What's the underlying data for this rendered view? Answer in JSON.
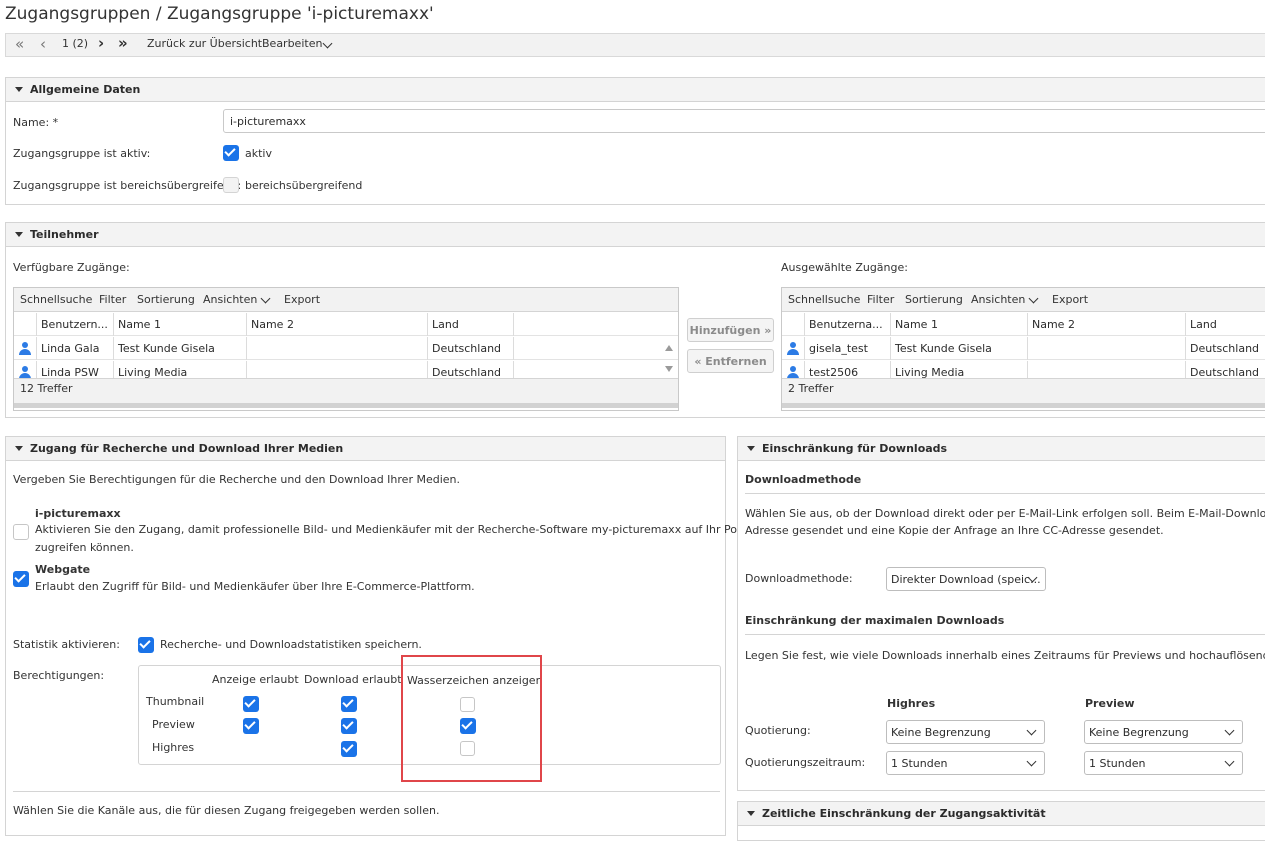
{
  "page_title": "Zugangsgruppen / Zugangsgruppe 'i-picturemaxx'",
  "toolbar": {
    "first": "«",
    "prev": "‹",
    "page_indicator": "1 (2)",
    "next": "›",
    "last": "»",
    "back_label": "Zurück zur Übersicht",
    "edit_label": "Bearbeiten"
  },
  "general": {
    "title": "Allgemeine Daten",
    "name_label": "Name: *",
    "name_value": "i-picturemaxx",
    "active_label": "Zugangsgruppe ist aktiv:",
    "active_text": "aktiv",
    "active_checked": true,
    "cross_label": "Zugangsgruppe ist bereichsübergreifend:",
    "cross_text": "bereichsübergreifend",
    "cross_checked": false
  },
  "participants": {
    "title": "Teilnehmer",
    "available_label": "Verfügbare Zugänge:",
    "selected_label": "Ausgewählte Zugänge:",
    "grid_toolbar": [
      "Schnellsuche",
      "Filter",
      "Sortierung",
      "Ansichten",
      "Export"
    ],
    "columns": [
      "Benutzern...",
      "Name 1",
      "Name 2",
      "Land"
    ],
    "columns_right": [
      "Benutzerna...",
      "Name 1",
      "Name 2",
      "Land"
    ],
    "available_rows": [
      {
        "user": "Linda Gala",
        "name1": "Test Kunde Gisela",
        "name2": "",
        "land": "Deutschland"
      },
      {
        "user": "Linda PSW",
        "name1": "Living Media",
        "name2": "",
        "land": "Deutschland"
      }
    ],
    "available_count": "12 Treffer",
    "selected_rows": [
      {
        "user": "gisela_test",
        "name1": "Test Kunde Gisela",
        "name2": "",
        "land": "Deutschland"
      },
      {
        "user": "test2506",
        "name1": "Living Media",
        "name2": "",
        "land": "Deutschland"
      }
    ],
    "selected_count": "2 Treffer",
    "add_button": "Hinzufügen »",
    "remove_button": "« Entfernen"
  },
  "access": {
    "title": "Zugang für Recherche und Download Ihrer Medien",
    "intro": "Vergeben Sie Berechtigungen für die Recherche und den Download Ihrer Medien.",
    "ipm_title": "i-picturemaxx",
    "ipm_desc1": "Aktivieren Sie den Zugang, damit professionelle Bild- und Medienkäufer mit der Recherche-Software my-picturemaxx auf Ihr Portfolio",
    "ipm_desc2": "zugreifen können.",
    "ipm_checked": false,
    "webgate_title": "Webgate",
    "webgate_desc": "Erlaubt den Zugriff für Bild- und Medienkäufer über Ihre E-Commerce-Plattform.",
    "webgate_checked": true,
    "stats_label": "Statistik aktivieren:",
    "stats_text": "Recherche- und Downloadstatistiken speichern.",
    "stats_checked": true,
    "perm_label": "Berechtigungen:",
    "perm_columns": [
      "Anzeige erlaubt",
      "Download erlaubt",
      "Wasserzeichen anzeigen"
    ],
    "perm_rows": [
      {
        "label": "Thumbnail",
        "view": true,
        "download": true,
        "watermark": false
      },
      {
        "label": "Preview",
        "view": true,
        "download": true,
        "watermark": true
      },
      {
        "label": "Highres",
        "view": null,
        "download": true,
        "watermark": false
      }
    ],
    "channels_text": "Wählen Sie die Kanäle aus, die für diesen Zugang freigegeben werden sollen."
  },
  "downloads": {
    "title": "Einschränkung für Downloads",
    "method_heading": "Downloadmethode",
    "method_desc1": "Wählen Sie aus, ob der Download direkt oder per E-Mail-Link erfolgen soll. Beim E-Mail-Download wird",
    "method_desc2": "Adresse gesendet und eine Kopie der Anfrage an Ihre CC-Adresse gesendet.",
    "method_label": "Downloadmethode:",
    "method_value": "Direkter Download (speic...",
    "max_heading": "Einschränkung der maximalen Downloads",
    "max_desc": "Legen Sie fest, wie viele Downloads innerhalb eines Zeitraums für Previews und hochauflösende Dateien",
    "col_highres": "Highres",
    "col_preview": "Preview",
    "quota_label": "Quotierung:",
    "quota_highres": "Keine Begrenzung",
    "quota_preview": "Keine Begrenzung",
    "period_label": "Quotierungszeitraum:",
    "period_highres": "1 Stunden",
    "period_preview": "1 Stunden"
  },
  "time_restriction": {
    "title": "Zeitliche Einschränkung der Zugangsaktivität"
  },
  "colors": {
    "accent": "#1a73e8",
    "highlight": "#e0464a",
    "user_icon": "#2c7be5"
  }
}
